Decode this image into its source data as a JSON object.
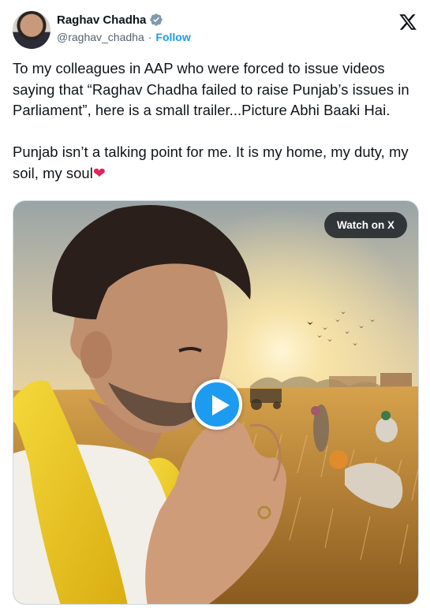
{
  "author": {
    "name": "Raghav Chadha",
    "handle": "@raghav_chadha",
    "separator": "·",
    "follow_label": "Follow"
  },
  "tweet": {
    "paragraph1": "To my colleagues in AAP who were forced to issue videos saying that “Raghav Chadha failed to raise Punjab’s issues in Parliament”, here is a small trailer...Picture Abhi Baaki Hai.",
    "paragraph2": "Punjab isn’t a talking point for me. It is my home, my duty, my soil, my soul",
    "heart_emoji": "❤"
  },
  "media": {
    "watch_label": "Watch on X"
  },
  "colors": {
    "accent": "#1d9bf0",
    "text": "#0f1419",
    "secondary": "#536471",
    "heart": "#e0245e"
  },
  "icons": [
    "verified-badge-icon",
    "x-logo-icon",
    "play-icon",
    "heart-emoji-icon"
  ]
}
